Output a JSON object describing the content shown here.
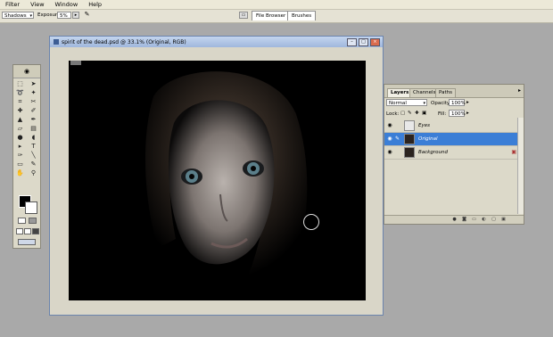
{
  "menu": [
    "Filter",
    "View",
    "Window",
    "Help"
  ],
  "options": {
    "range": "Shadows",
    "exposure_label": "Exposure:",
    "exposure_value": "5%",
    "file_browser": "File Browser",
    "brushes": "Brushes"
  },
  "document": {
    "title": "spirit of the dead.psd @ 33.1% (Original, RGB)"
  },
  "layers_panel": {
    "tabs": [
      "Layers",
      "Channels",
      "Paths"
    ],
    "blend_mode": "Normal",
    "opacity_label": "Opacity:",
    "opacity_value": "100%",
    "lock_label": "Lock:",
    "fill_label": "Fill:",
    "fill_value": "100%",
    "layers": [
      {
        "name": "Eyes",
        "selected": false
      },
      {
        "name": "Original",
        "selected": true
      },
      {
        "name": "Background",
        "selected": false
      }
    ]
  },
  "colors": {
    "foreground": "#000000",
    "background": "#ffffff",
    "selection": "#3b7ed6"
  }
}
